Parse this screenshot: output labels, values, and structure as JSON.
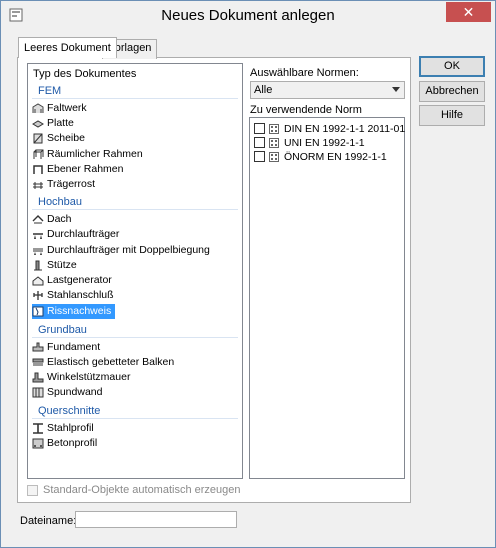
{
  "window": {
    "title": "Neues Dokument anlegen",
    "close_glyph": "✕",
    "accent": "#3399ff",
    "close_color": "#c75050"
  },
  "tabs": [
    {
      "label": "Leeres Dokument",
      "active": true
    },
    {
      "label": "Vorlagen",
      "active": false
    }
  ],
  "doc_types": {
    "header": "Typ des Dokumentes",
    "groups": [
      {
        "label": "FEM",
        "items": [
          {
            "label": "Faltwerk",
            "icon": "faltwerk-icon"
          },
          {
            "label": "Platte",
            "icon": "platte-icon"
          },
          {
            "label": "Scheibe",
            "icon": "scheibe-icon"
          },
          {
            "label": "Räumlicher Rahmen",
            "icon": "raeumlicher-rahmen-icon"
          },
          {
            "label": "Ebener Rahmen",
            "icon": "ebener-rahmen-icon"
          },
          {
            "label": "Trägerrost",
            "icon": "traegerrost-icon"
          }
        ]
      },
      {
        "label": "Hochbau",
        "items": [
          {
            "label": "Dach",
            "icon": "dach-icon"
          },
          {
            "label": "Durchlaufträger",
            "icon": "durchlauftraeger-icon"
          },
          {
            "label": "Durchlaufträger mit Doppelbiegung",
            "icon": "doppelbiegung-icon"
          },
          {
            "label": "Stütze",
            "icon": "stuetze-icon"
          },
          {
            "label": "Lastgenerator",
            "icon": "lastgenerator-icon"
          },
          {
            "label": "Stahlanschluß",
            "icon": "stahlanschluss-icon"
          },
          {
            "label": "Rissnachweis",
            "icon": "rissnachweis-icon",
            "selected": true
          }
        ]
      },
      {
        "label": "Grundbau",
        "items": [
          {
            "label": "Fundament",
            "icon": "fundament-icon"
          },
          {
            "label": "Elastisch gebetteter Balken",
            "icon": "gebetteter-balken-icon"
          },
          {
            "label": "Winkelstützmauer",
            "icon": "winkelstuetzmauer-icon"
          },
          {
            "label": "Spundwand",
            "icon": "spundwand-icon"
          }
        ]
      },
      {
        "label": "Querschnitte",
        "items": [
          {
            "label": "Stahlprofil",
            "icon": "stahlprofil-icon"
          },
          {
            "label": "Betonprofil",
            "icon": "betonprofil-icon"
          }
        ]
      }
    ]
  },
  "normen": {
    "label": "Auswählbare Normen:",
    "selected": "Alle",
    "list_label": "Zu verwendende Norm",
    "items": [
      {
        "label": "DIN EN 1992-1-1 2011-01",
        "checked": false
      },
      {
        "label": "UNI EN 1992-1-1",
        "checked": false
      },
      {
        "label": "ÖNORM EN 1992-1-1",
        "checked": false
      }
    ]
  },
  "buttons": {
    "ok": "OK",
    "cancel": "Abbrechen",
    "help": "Hilfe"
  },
  "auto_objects": {
    "label": "Standard-Objekte automatisch erzeugen",
    "checked": false,
    "enabled": false
  },
  "filename": {
    "label": "Dateiname:",
    "value": ""
  }
}
